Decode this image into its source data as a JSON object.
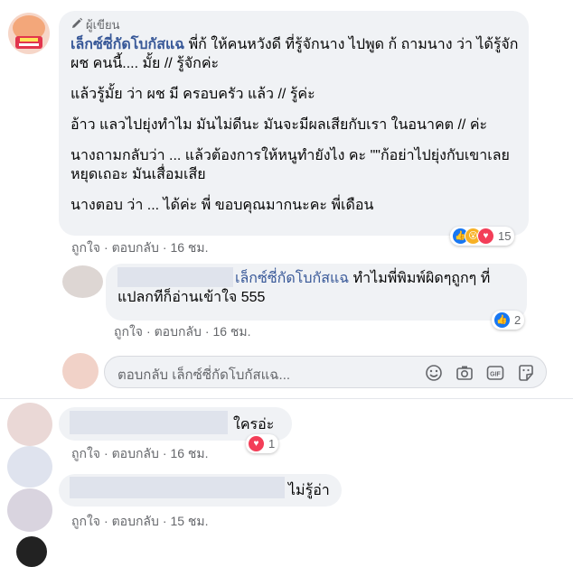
{
  "main_comment": {
    "badge": "ผู้เขียน",
    "author": "เล็กซ์ซี่กัดโบกัสแฉ",
    "paragraphs": [
      "พี่ก้ ให้คนหวังดี ที่รู้จักนาง ไปพูด ก้ ถามนาง ว่า ได้รู้จักผช คนนี้.... มั้ย // รู้จักค่ะ",
      "แล้วรู้มั้ย ว่า ผช มี ครอบครัว แล้ว // รู้ค่ะ",
      "อ้าว แลวไปยุ่งทำไม มันไม่ดีนะ มันจะมีผลเสียกับเรา ในอนาคต // ค่ะ",
      "นางถามกลับว่า ... แล้วต้องการให้หนูทำยังไง คะ \"\"ก้อย่าไปยุ่งกับเขาเลย หยุดเถอะ มันเสื่อมเสีย",
      "นางตอบ ว่า ... ได้ค่ะ พี่ ขอบคุณมากนะคะ พี่เดือน"
    ],
    "reactions_count": "15",
    "like": "ถูกใจ",
    "reply": "ตอบกลับ",
    "time": "16 ชม."
  },
  "reply_1": {
    "tag": "เล็กซ์ซี่กัดโบกัสแฉ",
    "text": "ทำไมพี่พิมพ์ผิดๆถูกๆ ที่แปลกทีก็อ่านเข้าใจ 555",
    "reactions_count": "2",
    "like": "ถูกใจ",
    "reply": "ตอบกลับ",
    "time": "16 ชม."
  },
  "reply_input": {
    "placeholder": "ตอบกลับ เล็กซ์ซี่กัดโบกัสแฉ..."
  },
  "comment_2": {
    "text": "ใครอ่ะ",
    "reactions_count": "1",
    "like": "ถูกใจ",
    "reply": "ตอบกลับ",
    "time": "16 ชม."
  },
  "comment_3": {
    "text": "ไม่รู้อ่า",
    "like": "ถูกใจ",
    "reply": "ตอบกลับ",
    "time": "15 ชม."
  },
  "colors": {
    "link": "#385898",
    "bubble": "#f0f2f5",
    "meta": "#65676b",
    "like_blue": "#1877f2",
    "love_red": "#f33e58",
    "wow_yellow": "#f7b125"
  },
  "icons": [
    "pencil-icon",
    "emoji-icon",
    "camera-icon",
    "gif-icon",
    "sticker-icon",
    "like-icon",
    "wow-icon",
    "love-icon"
  ]
}
